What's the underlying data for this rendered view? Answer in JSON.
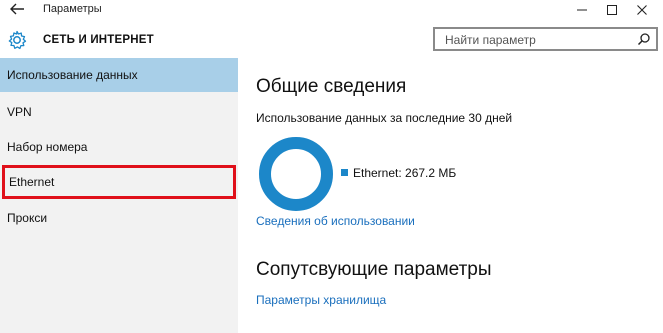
{
  "window": {
    "title": "Параметры"
  },
  "header": {
    "section_title": "СЕТЬ И ИНТЕРНЕТ",
    "search_placeholder": "Найти параметр"
  },
  "sidebar": {
    "items": [
      {
        "label": "Использование данных"
      },
      {
        "label": "VPN"
      },
      {
        "label": "Набор номера"
      },
      {
        "label": "Ethernet"
      },
      {
        "label": "Прокси"
      }
    ]
  },
  "main": {
    "overview_title": "Общие сведения",
    "usage_subtitle": "Использование данных за последние 30 дней",
    "legend_label": "Ethernet: 267.2 МБ",
    "usage_details_link": "Сведения об использовании",
    "related_title": "Сопутсвующие параметры",
    "storage_link": "Параметры хранилища"
  },
  "colors": {
    "accent": "#1c87c9",
    "selected_bg": "#a8cfe8",
    "highlight_border": "#e0101a",
    "link": "#1a6fbd"
  },
  "chart_data": {
    "type": "pie",
    "labels": [
      "Ethernet"
    ],
    "values": [
      267.2
    ],
    "unit": "МБ"
  }
}
